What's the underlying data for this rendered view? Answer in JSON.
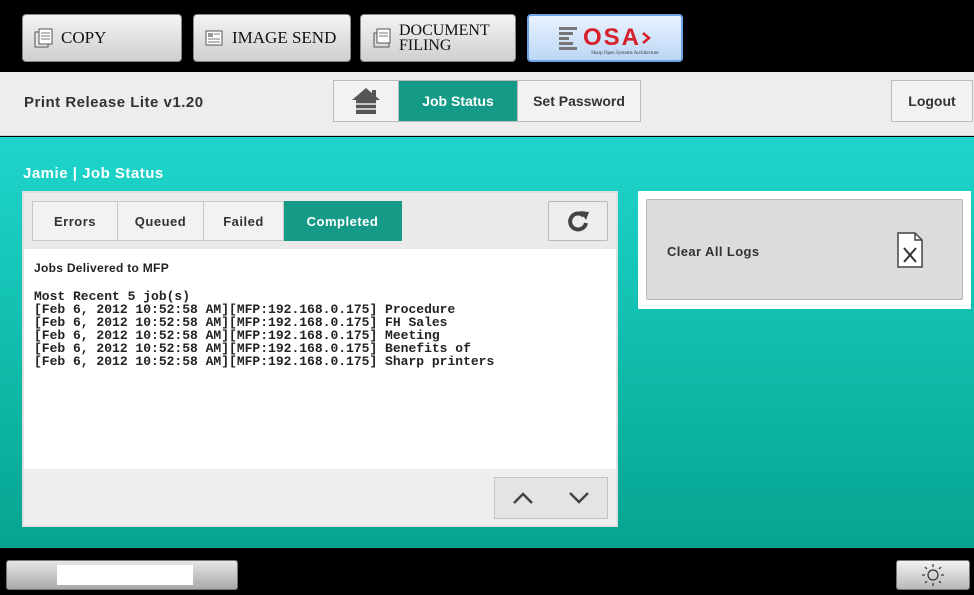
{
  "modes": {
    "copy_label": "COPY",
    "image_send_label": "IMAGE SEND",
    "document_filing_line1": "DOCUMENT",
    "document_filing_line2": "FILING",
    "osa_label": "OSA",
    "osa_tagline": "Sharp Open Systems Architecture"
  },
  "header": {
    "app_title": "Print Release Lite  v1.20",
    "home_icon": "home-icon",
    "tabs": [
      {
        "label": "Job Status",
        "active": true
      },
      {
        "label": "Set Password",
        "active": false
      }
    ],
    "logout_label": "Logout"
  },
  "main": {
    "heading": "Jamie | Job Status",
    "filters": [
      {
        "label": "Errors",
        "active": false
      },
      {
        "label": "Queued",
        "active": false
      },
      {
        "label": "Failed",
        "active": false
      },
      {
        "label": "Completed",
        "active": true
      }
    ],
    "log_heading": "Jobs Delivered to MFP",
    "log_subheading": "Most Recent 5 job(s)",
    "log_lines": [
      "[Feb 6, 2012 10:52:58 AM][MFP:192.168.0.175] Procedure",
      "[Feb 6, 2012 10:52:58 AM][MFP:192.168.0.175] FH Sales",
      "[Feb 6, 2012 10:52:58 AM][MFP:192.168.0.175] Meeting",
      "[Feb 6, 2012 10:52:58 AM][MFP:192.168.0.175] Benefits of",
      "[Feb 6, 2012 10:52:58 AM][MFP:192.168.0.175] Sharp printers"
    ],
    "clear_logs_label": "Clear All Logs"
  },
  "colors": {
    "accent": "#149a86",
    "teal_top": "#1fd5cc",
    "teal_bottom": "#06a490",
    "osa_red": "#d6202a"
  }
}
